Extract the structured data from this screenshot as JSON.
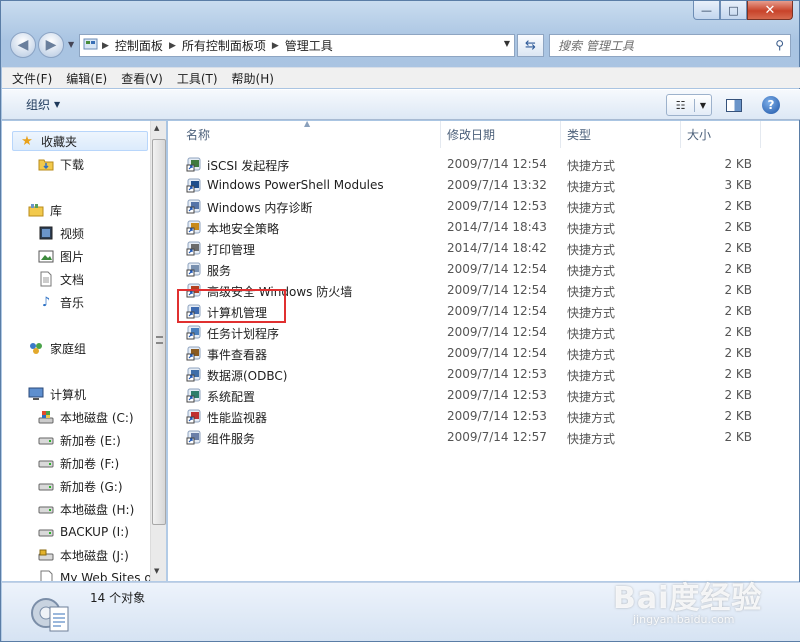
{
  "window": {
    "caption": {
      "minimize": "—",
      "maximize": "□",
      "close": "✕"
    }
  },
  "address": {
    "crumbs": [
      "控制面板",
      "所有控制面板项",
      "管理工具"
    ]
  },
  "search": {
    "placeholder": "搜索 管理工具"
  },
  "menu": [
    "文件(F)",
    "编辑(E)",
    "查看(V)",
    "工具(T)",
    "帮助(H)"
  ],
  "toolbar": {
    "organize": "组织"
  },
  "nav": {
    "favorites": "收藏夹",
    "downloads": "下载",
    "libraries": "库",
    "videos": "视频",
    "pictures": "图片",
    "documents": "文档",
    "music": "音乐",
    "homegroup": "家庭组",
    "computer": "计算机",
    "drives": [
      "本地磁盘 (C:)",
      "新加卷 (E:)",
      "新加卷 (F:)",
      "新加卷 (G:)",
      "本地磁盘 (H:)",
      "BACKUP (I:)",
      "本地磁盘 (J:)",
      "My Web Sites o"
    ]
  },
  "columns": {
    "name": "名称",
    "date": "修改日期",
    "type": "类型",
    "size": "大小"
  },
  "files": [
    {
      "name": "iSCSI 发起程序",
      "date": "2009/7/14 12:54",
      "type": "快捷方式",
      "size": "2 KB",
      "icon": "iscsi-icon"
    },
    {
      "name": "Windows PowerShell Modules",
      "date": "2009/7/14 13:32",
      "type": "快捷方式",
      "size": "3 KB",
      "icon": "powershell-icon"
    },
    {
      "name": "Windows 内存诊断",
      "date": "2009/7/14 12:53",
      "type": "快捷方式",
      "size": "2 KB",
      "icon": "memory-diagnostic-icon"
    },
    {
      "name": "本地安全策略",
      "date": "2014/7/14 18:43",
      "type": "快捷方式",
      "size": "2 KB",
      "icon": "security-policy-icon"
    },
    {
      "name": "打印管理",
      "date": "2014/7/14 18:42",
      "type": "快捷方式",
      "size": "2 KB",
      "icon": "print-management-icon"
    },
    {
      "name": "服务",
      "date": "2009/7/14 12:54",
      "type": "快捷方式",
      "size": "2 KB",
      "icon": "services-icon"
    },
    {
      "name": "高级安全 Windows 防火墙",
      "date": "2009/7/14 12:54",
      "type": "快捷方式",
      "size": "2 KB",
      "icon": "firewall-icon"
    },
    {
      "name": "计算机管理",
      "date": "2009/7/14 12:54",
      "type": "快捷方式",
      "size": "2 KB",
      "icon": "computer-management-icon"
    },
    {
      "name": "任务计划程序",
      "date": "2009/7/14 12:54",
      "type": "快捷方式",
      "size": "2 KB",
      "icon": "task-scheduler-icon"
    },
    {
      "name": "事件查看器",
      "date": "2009/7/14 12:54",
      "type": "快捷方式",
      "size": "2 KB",
      "icon": "event-viewer-icon"
    },
    {
      "name": "数据源(ODBC)",
      "date": "2009/7/14 12:53",
      "type": "快捷方式",
      "size": "2 KB",
      "icon": "odbc-icon"
    },
    {
      "name": "系统配置",
      "date": "2009/7/14 12:53",
      "type": "快捷方式",
      "size": "2 KB",
      "icon": "system-config-icon"
    },
    {
      "name": "性能监视器",
      "date": "2009/7/14 12:53",
      "type": "快捷方式",
      "size": "2 KB",
      "icon": "performance-monitor-icon"
    },
    {
      "name": "组件服务",
      "date": "2009/7/14 12:57",
      "type": "快捷方式",
      "size": "2 KB",
      "icon": "component-services-icon"
    }
  ],
  "status": {
    "count": "14 个对象"
  },
  "watermark": {
    "main": "Bai度经验",
    "sub": "jingyan.baidu.com"
  },
  "colors": {
    "highlight": "#e03030",
    "accent": "#1d54a5"
  }
}
